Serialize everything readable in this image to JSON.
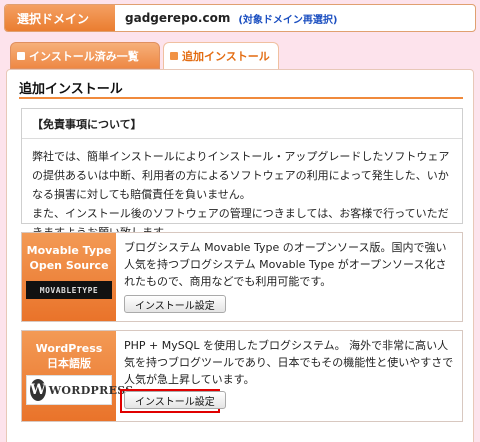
{
  "topbar": {
    "label": "選択ドメイン",
    "domain": "gadgerepo.com",
    "reselect": "(対象ドメイン再選択)"
  },
  "tabs": {
    "list_label": "インストール済み一覧",
    "add_label": "追加インストール"
  },
  "section": {
    "title": "追加インストール"
  },
  "disclaimer": {
    "heading": "【免責事項について】",
    "paragraph1": "弊社では、簡単インストールによりインストール・アップグレードしたソフトウェアの提供あるいは中断、利用者の方によるソフトウェアの利用によって発生した、いかなる損害に対しても賠償責任を負いません。",
    "paragraph2": "また、インストール後のソフトウェアの管理につきましては、お客様で行っていただきますようお願い致します。"
  },
  "apps": [
    {
      "name_line1": "Movable Type",
      "name_line2": "Open Source",
      "logo_text": "MOVABLETYPE",
      "description": "ブログシステム Movable Type のオープンソース版。国内で強い人気を持つブログシステム Movable Type がオープンソース化されたもので、商用などでも利用可能です。",
      "button_label": "インストール設定"
    },
    {
      "name_line1": "WordPress",
      "name_line2": "日本語版",
      "logo_text": "WORDPRESS",
      "logo_mark": "W",
      "description": "PHP + MySQL を使用したブログシステム。 海外で非常に高い人気を持つブログツールであり、日本でもその機能性と使いやすさで人気が急上昇しています。",
      "button_label": "インストール設定"
    }
  ],
  "colors": {
    "accent": "#ea7d30",
    "background": "#fde3ec",
    "link": "#1a4ec0",
    "highlight": "#e00000"
  }
}
